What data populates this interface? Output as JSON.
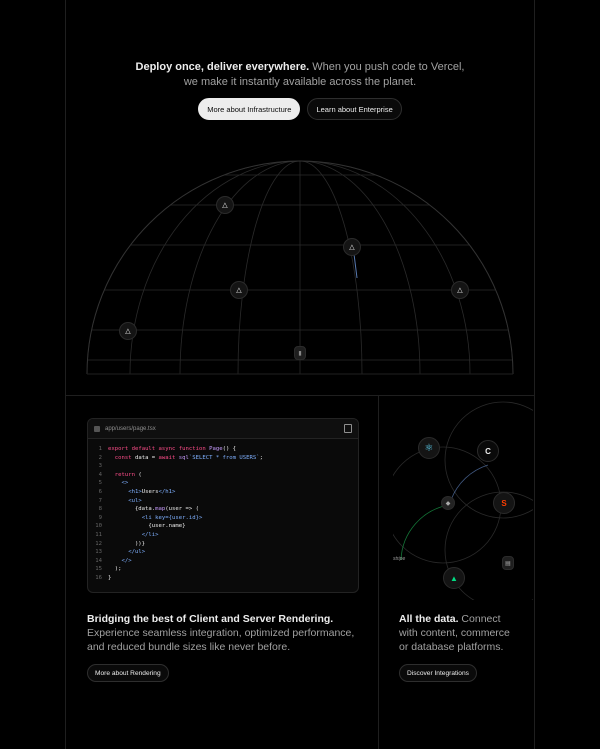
{
  "hero": {
    "lead": "Deploy once, deliver everywhere.",
    "body": " When you push code to Vercel, we make it instantly available across the planet.",
    "primary_button": "More about Infrastructure",
    "secondary_button": "Learn about Enterprise"
  },
  "globe": {
    "center_node_glyph": "▮",
    "node_glyph": "△"
  },
  "code": {
    "filename": "app/users/page.tsx",
    "lines": [
      "export default async function Page() {",
      "  const data = await sql`SELECT * from USERS`;",
      "",
      "  return (",
      "    <>",
      "      <h1>Users</h1>",
      "      <ul>",
      "        {data.map(user => (",
      "          <li key={user.id}>",
      "            {user.name}",
      "          </li>",
      "        ))}",
      "      </ul>",
      "    </>",
      "  );",
      "}"
    ]
  },
  "rendering": {
    "title": "Bridging the best of Client and Server Rendering.",
    "body": "Experience seamless integration, optimized performance, and reduced bundle sizes like never before.",
    "button": "More about Rendering"
  },
  "data_section": {
    "title": "All the data.",
    "body": " Connect with content, commerce or database platforms.",
    "button": "Discover Integrations"
  },
  "integrations": {
    "react_glyph": "⚛",
    "c_glyph": "C",
    "svelte_glyph": "S",
    "stripe_label": "stripe",
    "nuxt_glyph": "▲",
    "db_glyph": "▤",
    "colors": {
      "react": "#61dafb",
      "svelte": "#ff3e00",
      "nuxt": "#00dc82"
    }
  }
}
